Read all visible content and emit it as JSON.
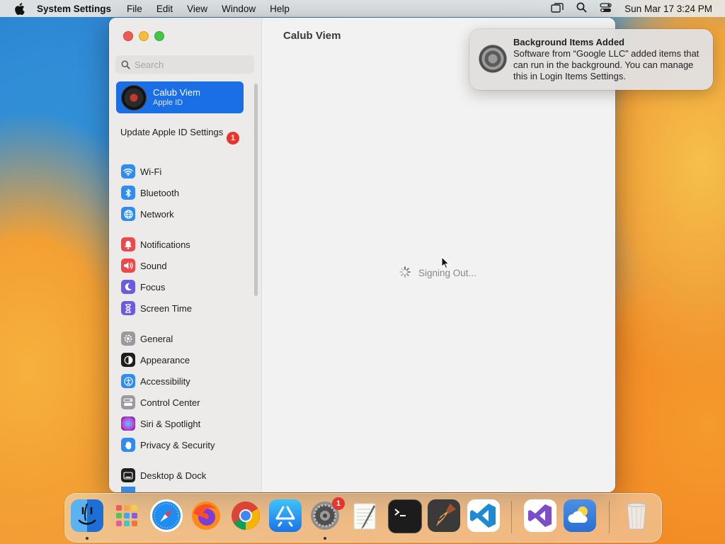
{
  "menubar": {
    "app_name": "System Settings",
    "menus": [
      "File",
      "Edit",
      "View",
      "Window",
      "Help"
    ],
    "clock": "Sun Mar 17  3:24 PM"
  },
  "window": {
    "search_placeholder": "Search",
    "profile": {
      "name": "Calub Viem",
      "subtitle": "Apple ID"
    },
    "update_label": "Update Apple ID Settings",
    "update_badge": "1",
    "sidebar_items": [
      {
        "label": "Wi-Fi",
        "icon": "wifi-icon",
        "color": "#2f8cf0"
      },
      {
        "label": "Bluetooth",
        "icon": "bluetooth-icon",
        "color": "#2f8cf0"
      },
      {
        "label": "Network",
        "icon": "globe-icon",
        "color": "#2f8cf0"
      },
      {
        "label": "Notifications",
        "icon": "bell-icon",
        "color": "#f0474a"
      },
      {
        "label": "Sound",
        "icon": "speaker-icon",
        "color": "#f0474a"
      },
      {
        "label": "Focus",
        "icon": "moon-icon",
        "color": "#6a5be0"
      },
      {
        "label": "Screen Time",
        "icon": "hourglass-icon",
        "color": "#6a5be0"
      },
      {
        "label": "General",
        "icon": "gear-icon",
        "color": "#9a9a9e"
      },
      {
        "label": "Appearance",
        "icon": "appearance-icon",
        "color": "#1e1e1e"
      },
      {
        "label": "Accessibility",
        "icon": "accessibility-icon",
        "color": "#2f8cf0"
      },
      {
        "label": "Control Center",
        "icon": "control-center-icon",
        "color": "#9a9a9e"
      },
      {
        "label": "Siri & Spotlight",
        "icon": "siri-icon",
        "color": "#d03ea8"
      },
      {
        "label": "Privacy & Security",
        "icon": "hand-icon",
        "color": "#2f8cf0"
      },
      {
        "label": "Desktop & Dock",
        "icon": "dock-icon",
        "color": "#1e1e1e"
      }
    ],
    "content_title": "Calub Viem",
    "status_text": "Signing Out..."
  },
  "notification": {
    "title": "Background Items Added",
    "body": "Software from “Google LLC” added items that can run in the background. You can manage this in Login Items Settings."
  },
  "dock": {
    "apps": [
      "Finder",
      "Launchpad",
      "Safari",
      "Firefox",
      "Google Chrome",
      "App Store",
      "System Settings",
      "TextEdit",
      "Terminal",
      "Instruments",
      "Visual Studio Code",
      "Visual Studio",
      "Weather",
      "Trash"
    ],
    "settings_badge": "1"
  }
}
